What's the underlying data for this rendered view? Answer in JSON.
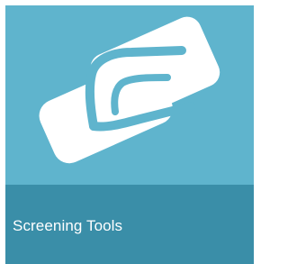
{
  "tile": {
    "label": "Screening Tools",
    "icon": "handshake-icon",
    "colors": {
      "top": "#5fb4cd",
      "bottom": "#3a8ea8",
      "text": "#ffffff",
      "icon": "#ffffff"
    }
  }
}
